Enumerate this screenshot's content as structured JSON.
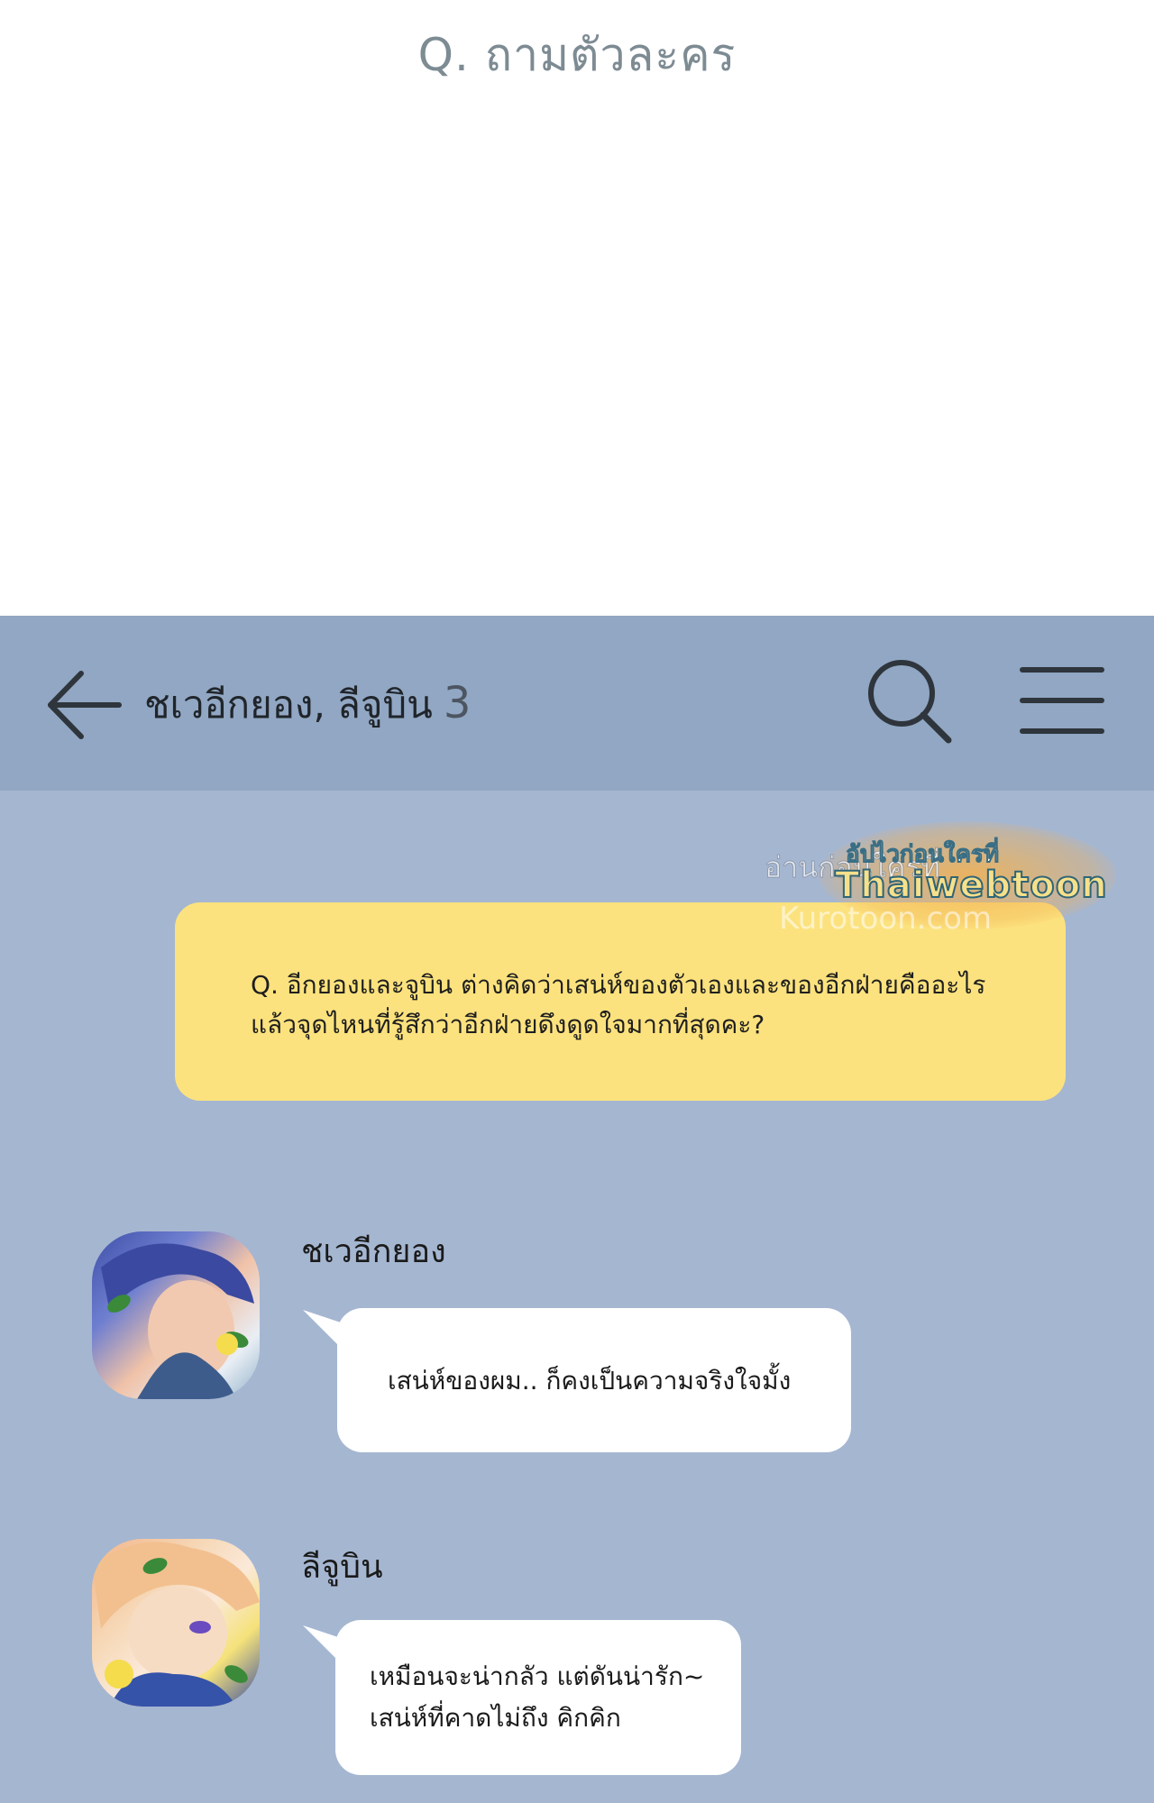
{
  "page": {
    "title": "Q. ถามตัวละคร"
  },
  "header": {
    "chat_name": "ชเวอีกยอง, ลีจูบิน",
    "member_count": "3",
    "back_icon": "arrow-left-icon",
    "search_icon": "search-icon",
    "menu_icon": "hamburger-menu-icon"
  },
  "watermark": {
    "line1": "อ่านก่อนใครที่",
    "sub": "อัปไวก่อนใครที่",
    "brand": "Thaiwebtoon",
    "site": "Kurotoon.com"
  },
  "question": {
    "lines": [
      "Q. อีกยองและจูบิน ต่างคิดว่าเสน่ห์ของตัวเองและของอีกฝ่ายคืออะไร",
      "แล้วจุดไหนที่รู้สึกว่าอีกฝ่ายดึงดูดใจมากที่สุดคะ?"
    ]
  },
  "messages": [
    {
      "sender": "ชเวอีกยอง",
      "lines": [
        "เสน่ห์ของผม.. ก็คงเป็นความจริงใจมั้ง"
      ]
    },
    {
      "sender": "ลีจูบิน",
      "lines": [
        "เหมือนจะน่ากลัว แต่ดันน่ารัก~",
        "เสน่ห์ที่คาดไม่ถึง คิกคิก"
      ]
    }
  ],
  "colors": {
    "chat_background": "#a5b6d1",
    "header_background": "#91a7c3",
    "question_bubble": "#fce27e",
    "message_bubble": "#ffffff",
    "title_text": "#7d8b93"
  }
}
